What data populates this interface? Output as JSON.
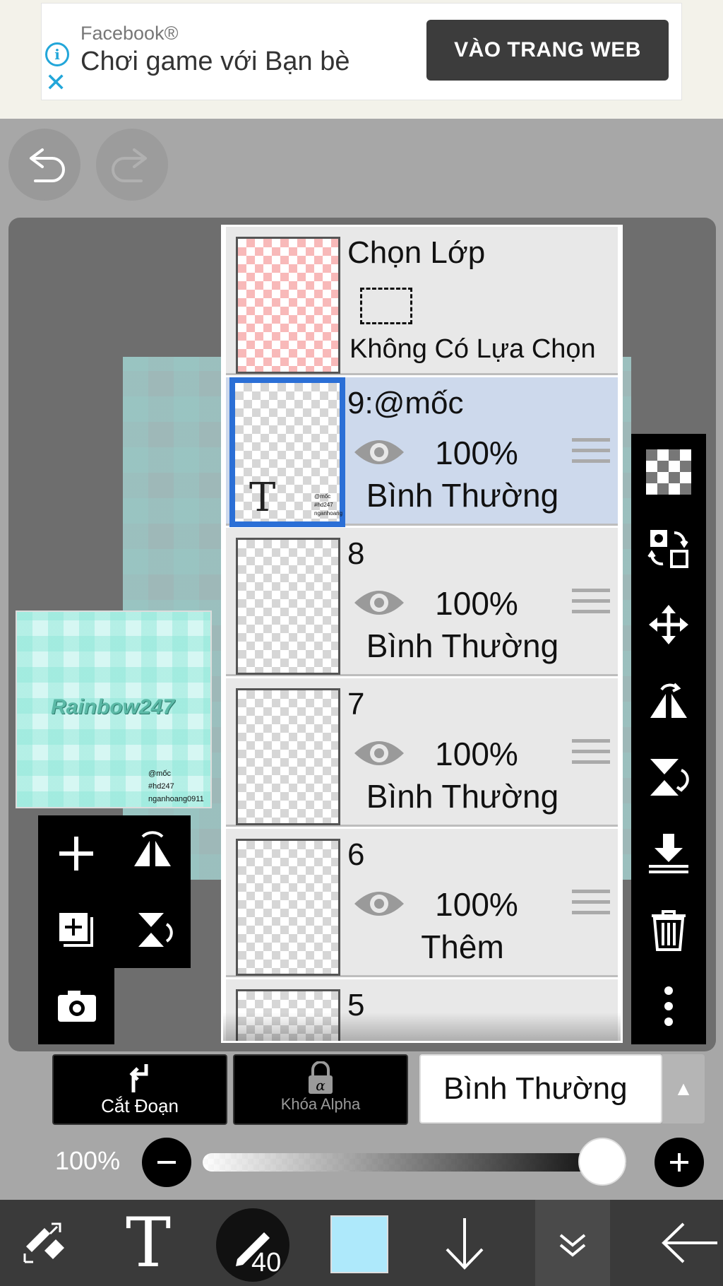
{
  "ad": {
    "brand": "Facebook®",
    "headline": "Chơi game với Bạn bè",
    "cta": "VÀO TRANG WEB",
    "info_glyph": "i",
    "close_glyph": "✕"
  },
  "preview": {
    "art_text": "Rainbow247",
    "lines": [
      "@mốc",
      "#hd247",
      "nganhoang0911"
    ]
  },
  "layers": {
    "selection_layer": {
      "title": "Chọn Lớp",
      "caption": "Không Có Lựa Chọn"
    },
    "items": [
      {
        "name": "9:@mốc",
        "opacity": "100%",
        "mode": "Bình Thường",
        "selected": true,
        "thumb_lines": [
          "@mốc",
          "#hd247",
          "nganhoang"
        ]
      },
      {
        "name": "8",
        "opacity": "100%",
        "mode": "Bình Thường",
        "selected": false
      },
      {
        "name": "7",
        "opacity": "100%",
        "mode": "Bình Thường",
        "selected": false
      },
      {
        "name": "6",
        "opacity": "100%",
        "mode": "Thêm",
        "selected": false
      },
      {
        "name": "5"
      }
    ]
  },
  "controls": {
    "clipping_label": "Cắt Đoạn",
    "alpha_lock_label": "Khóa Alpha",
    "blend_mode": "Bình Thường",
    "opacity_label": "100%",
    "opacity_value": 1.0
  },
  "bottom": {
    "text_tool_glyph": "T",
    "brush_size": "40",
    "current_color": "#aee9fb"
  },
  "colors": {
    "selected_row": "#cdd9ec",
    "selection_border": "#2b6fd6",
    "ad_accent": "#22a6d9"
  },
  "icons": {
    "left_pad": [
      "add-layer-icon",
      "flip-horizontal-icon",
      "duplicate-layer-icon",
      "flip-vertical-icon",
      "camera-icon"
    ],
    "right_bar": [
      "transparency-icon",
      "layer-swap-icon",
      "move-icon",
      "flip-horizontal-icon",
      "flip-vertical-icon",
      "merge-down-icon",
      "trash-icon",
      "more-vertical-icon"
    ],
    "bottom_bar": [
      "transform-tools-icon",
      "text-tool-icon",
      "brush-icon",
      "color-swatch",
      "arrow-down-icon",
      "double-chevron-down-icon",
      "back-arrow-icon"
    ]
  }
}
